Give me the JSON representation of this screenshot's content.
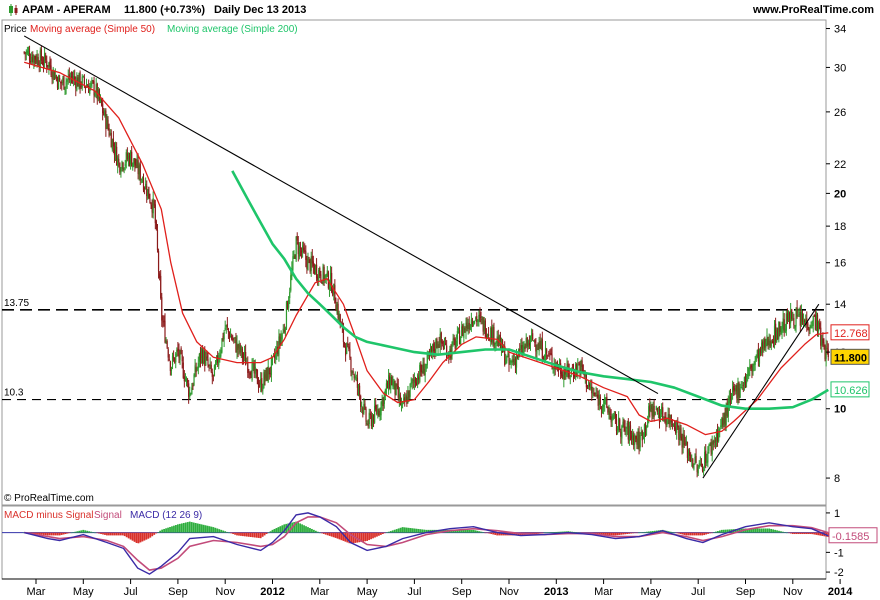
{
  "header": {
    "symbol_line": "APAM - APERAM",
    "price_change": "11.800 (+0.73%)",
    "period_date": "Daily  Dec 13 2013",
    "site": "www.ProRealTime.com",
    "watermark": "© ProRealTime.com"
  },
  "colors": {
    "candle_up": "#2e9a2e",
    "candle_down": "#8b1a1a",
    "ma50": "#e0201c",
    "ma200": "#1fc56a",
    "trendline": "#000000",
    "macd_line": "#3a2aa6",
    "signal_line": "#c24b7a",
    "hist_pos": "#2fae3f",
    "hist_neg": "#d9312b",
    "zero_line": "#3333aa"
  },
  "chart_data": [
    {
      "type": "candlestick",
      "title": "Price",
      "legend": [
        {
          "name": "Price",
          "color": "#000000"
        },
        {
          "name": "Moving average (Simple 50)",
          "color": "#e0201c"
        },
        {
          "name": "Moving average (Simple 200)",
          "color": "#1fc56a"
        }
      ],
      "y_scale": "log",
      "ylim": [
        7.6,
        34.5
      ],
      "y_ticks": [
        34,
        30,
        26,
        22,
        20,
        18,
        16,
        14,
        12,
        10,
        8
      ],
      "y_ticks_bold": [
        20,
        10
      ],
      "x_labels": [
        {
          "label": "Mar",
          "t": 0
        },
        {
          "label": "May",
          "t": 2
        },
        {
          "label": "Jul",
          "t": 4
        },
        {
          "label": "Sep",
          "t": 6
        },
        {
          "label": "Nov",
          "t": 8
        },
        {
          "label": "2012",
          "t": 10,
          "bold": true
        },
        {
          "label": "Mar",
          "t": 12
        },
        {
          "label": "May",
          "t": 14
        },
        {
          "label": "Jul",
          "t": 16
        },
        {
          "label": "Sep",
          "t": 18
        },
        {
          "label": "Nov",
          "t": 20
        },
        {
          "label": "2013",
          "t": 22,
          "bold": true
        },
        {
          "label": "Mar",
          "t": 24
        },
        {
          "label": "May",
          "t": 26
        },
        {
          "label": "Jul",
          "t": 28
        },
        {
          "label": "Sep",
          "t": 30
        },
        {
          "label": "Nov",
          "t": 32
        },
        {
          "label": "2014",
          "t": 34,
          "bold": true
        }
      ],
      "price_path": [
        [
          -0.5,
          31.5
        ],
        [
          0,
          31
        ],
        [
          0.5,
          30.5
        ],
        [
          1,
          28.5
        ],
        [
          1.5,
          29
        ],
        [
          2,
          28.5
        ],
        [
          2.5,
          28
        ],
        [
          3,
          25
        ],
        [
          3.5,
          22
        ],
        [
          4,
          22.5
        ],
        [
          4.5,
          21
        ],
        [
          5,
          19
        ],
        [
          5.3,
          13.5
        ],
        [
          5.7,
          11.5
        ],
        [
          6,
          12
        ],
        [
          6.5,
          10.5
        ],
        [
          7,
          12
        ],
        [
          7.5,
          11
        ],
        [
          8,
          13
        ],
        [
          8.5,
          12.2
        ],
        [
          9,
          11.5
        ],
        [
          9.5,
          10.8
        ],
        [
          10,
          11.5
        ],
        [
          10.5,
          13
        ],
        [
          11,
          17
        ],
        [
          11.5,
          16
        ],
        [
          12,
          15.5
        ],
        [
          12.5,
          15
        ],
        [
          13,
          12.5
        ],
        [
          13.5,
          11
        ],
        [
          14,
          9.5
        ],
        [
          14.5,
          10
        ],
        [
          15,
          11
        ],
        [
          15.5,
          10
        ],
        [
          16,
          11
        ],
        [
          16.5,
          11.5
        ],
        [
          17,
          12.5
        ],
        [
          17.5,
          12
        ],
        [
          18,
          12.8
        ],
        [
          18.5,
          13.5
        ],
        [
          19,
          13
        ],
        [
          19.5,
          12.5
        ],
        [
          20,
          11.5
        ],
        [
          20.5,
          12
        ],
        [
          21,
          12.5
        ],
        [
          21.5,
          12
        ],
        [
          22,
          11.5
        ],
        [
          22.5,
          11.2
        ],
        [
          23,
          11.5
        ],
        [
          23.5,
          10.5
        ],
        [
          24,
          10.2
        ],
        [
          24.5,
          9.5
        ],
        [
          25,
          9.3
        ],
        [
          25.5,
          9
        ],
        [
          26,
          10
        ],
        [
          26.5,
          9.8
        ],
        [
          27,
          9.6
        ],
        [
          27.5,
          8.8
        ],
        [
          28,
          8.2
        ],
        [
          28.5,
          8.8
        ],
        [
          29,
          9.5
        ],
        [
          29.5,
          10.5
        ],
        [
          30,
          11
        ],
        [
          30.5,
          11.8
        ],
        [
          31,
          12.5
        ],
        [
          31.5,
          13
        ],
        [
          32,
          13.5
        ],
        [
          32.5,
          13.2
        ],
        [
          33,
          13.3
        ],
        [
          33.2,
          12.4
        ],
        [
          33.5,
          11.8
        ]
      ],
      "series": [
        {
          "name": "Moving average (Simple 50)",
          "color": "#e0201c",
          "values": [
            [
              -0.5,
              30.5
            ],
            [
              1,
              29.5
            ],
            [
              2.5,
              27.8
            ],
            [
              3.5,
              25.5
            ],
            [
              4.5,
              22
            ],
            [
              5.3,
              19
            ],
            [
              5.7,
              16
            ],
            [
              6.2,
              13.6
            ],
            [
              6.8,
              12.4
            ],
            [
              7.5,
              11.8
            ],
            [
              8.5,
              11.6
            ],
            [
              9.5,
              11.6
            ],
            [
              10,
              11.8
            ],
            [
              10.5,
              12.5
            ],
            [
              11,
              13.5
            ],
            [
              11.8,
              15
            ],
            [
              12.3,
              15.2
            ],
            [
              13,
              14
            ],
            [
              13.5,
              12.6
            ],
            [
              14,
              11.3
            ],
            [
              14.7,
              10.5
            ],
            [
              15.3,
              10.2
            ],
            [
              16,
              10.3
            ],
            [
              16.6,
              10.9
            ],
            [
              17.2,
              11.6
            ],
            [
              18,
              12.3
            ],
            [
              18.6,
              12.6
            ],
            [
              19.5,
              12.5
            ],
            [
              20,
              12
            ],
            [
              21,
              11.7
            ],
            [
              22,
              11.4
            ],
            [
              23,
              11.1
            ],
            [
              24,
              10.7
            ],
            [
              25,
              10.4
            ],
            [
              25.5,
              9.8
            ],
            [
              26,
              9.6
            ],
            [
              26.7,
              9.7
            ],
            [
              27.5,
              9.5
            ],
            [
              28.3,
              9.2
            ],
            [
              29,
              9.3
            ],
            [
              29.5,
              9.6
            ],
            [
              30.5,
              10.3
            ],
            [
              31.5,
              11.4
            ],
            [
              32.5,
              12.3
            ],
            [
              33,
              12.7
            ],
            [
              33.5,
              12.77
            ]
          ]
        },
        {
          "name": "Moving average (Simple 200)",
          "color": "#1fc56a",
          "values": [
            [
              8.3,
              21.5
            ],
            [
              9,
              19.5
            ],
            [
              9.5,
              18.2
            ],
            [
              10,
              17
            ],
            [
              10.5,
              16.2
            ],
            [
              11,
              15.2
            ],
            [
              11.5,
              14.5
            ],
            [
              12,
              14
            ],
            [
              12.5,
              13.5
            ],
            [
              13,
              13
            ],
            [
              13.5,
              12.6
            ],
            [
              14,
              12.4
            ],
            [
              15,
              12.2
            ],
            [
              16,
              12
            ],
            [
              17,
              11.9
            ],
            [
              18,
              12
            ],
            [
              19,
              12.1
            ],
            [
              20,
              12.1
            ],
            [
              21,
              11.8
            ],
            [
              22,
              11.5
            ],
            [
              23,
              11.25
            ],
            [
              24,
              11.1
            ],
            [
              25,
              11
            ],
            [
              26,
              10.9
            ],
            [
              27,
              10.7
            ],
            [
              28,
              10.4
            ],
            [
              29,
              10.1
            ],
            [
              30,
              10
            ],
            [
              31,
              10
            ],
            [
              32,
              10.05
            ],
            [
              32.8,
              10.3
            ],
            [
              33.5,
              10.626
            ]
          ]
        }
      ],
      "levels": [
        {
          "label": "13.75",
          "value": 13.75
        },
        {
          "label": "10.3",
          "value": 10.3
        }
      ],
      "trendlines": [
        {
          "from": [
            -0.5,
            33.2
          ],
          "to": [
            26.3,
            10.5
          ]
        },
        {
          "from": [
            28.2,
            8.0
          ],
          "to": [
            33.1,
            14.0
          ]
        }
      ],
      "price_tags": [
        {
          "label": "12.768",
          "value": 12.768,
          "style": "outline",
          "color": "#e0201c"
        },
        {
          "label": "11.800",
          "value": 11.8,
          "style": "filled",
          "color": "#ffd500"
        },
        {
          "label": "10.626",
          "value": 10.626,
          "style": "outline",
          "color": "#1fc56a"
        }
      ]
    },
    {
      "type": "line",
      "title": "MACD minus Signal",
      "legend": [
        {
          "name": "MACD minus Signal",
          "color": "#d9312b"
        },
        {
          "name": "Signal",
          "color": "#c24b7a"
        },
        {
          "name": "MACD (12 26 9)",
          "color": "#3a2aa6"
        }
      ],
      "ylim": [
        -2.3,
        1.3
      ],
      "y_ticks": [
        1,
        -1,
        -2
      ],
      "current_value": {
        "label": "-0.1585",
        "value": -0.1585
      },
      "macd_path": [
        [
          -0.5,
          0
        ],
        [
          0.5,
          -0.3
        ],
        [
          1,
          -0.4
        ],
        [
          2,
          -0.1
        ],
        [
          3,
          -0.5
        ],
        [
          3.7,
          -0.8
        ],
        [
          4.3,
          -1.8
        ],
        [
          4.8,
          -2.1
        ],
        [
          5.3,
          -1.7
        ],
        [
          6,
          -1.0
        ],
        [
          6.5,
          -0.3
        ],
        [
          7.5,
          -0.2
        ],
        [
          8.5,
          -0.6
        ],
        [
          9.5,
          -0.9
        ],
        [
          10,
          -0.5
        ],
        [
          10.5,
          0.1
        ],
        [
          11,
          0.9
        ],
        [
          11.5,
          1.0
        ],
        [
          12,
          0.8
        ],
        [
          12.7,
          0.3
        ],
        [
          13.3,
          -0.5
        ],
        [
          14,
          -0.9
        ],
        [
          14.8,
          -0.7
        ],
        [
          15.5,
          -0.3
        ],
        [
          16.5,
          0.0
        ],
        [
          17.5,
          0.2
        ],
        [
          18.5,
          0.3
        ],
        [
          19.5,
          0.0
        ],
        [
          20.5,
          -0.15
        ],
        [
          21.5,
          -0.1
        ],
        [
          22.5,
          0.0
        ],
        [
          23.5,
          -0.1
        ],
        [
          24.5,
          -0.3
        ],
        [
          25.5,
          -0.2
        ],
        [
          26.5,
          0.1
        ],
        [
          27.5,
          -0.3
        ],
        [
          28.2,
          -0.5
        ],
        [
          29,
          -0.1
        ],
        [
          30,
          0.3
        ],
        [
          31,
          0.5
        ],
        [
          32,
          0.3
        ],
        [
          32.8,
          0.2
        ],
        [
          33.5,
          -0.1585
        ]
      ],
      "signal_path": [
        [
          -0.5,
          0
        ],
        [
          0.5,
          -0.2
        ],
        [
          1,
          -0.3
        ],
        [
          2,
          -0.2
        ],
        [
          3,
          -0.4
        ],
        [
          3.7,
          -0.7
        ],
        [
          4.3,
          -1.4
        ],
        [
          4.8,
          -1.9
        ],
        [
          5.3,
          -1.8
        ],
        [
          6,
          -1.3
        ],
        [
          6.5,
          -0.7
        ],
        [
          7.5,
          -0.4
        ],
        [
          8.5,
          -0.5
        ],
        [
          9.5,
          -0.7
        ],
        [
          10,
          -0.6
        ],
        [
          10.5,
          -0.2
        ],
        [
          11,
          0.5
        ],
        [
          11.5,
          0.8
        ],
        [
          12,
          0.8
        ],
        [
          12.7,
          0.5
        ],
        [
          13.3,
          -0.1
        ],
        [
          14,
          -0.6
        ],
        [
          14.8,
          -0.7
        ],
        [
          15.5,
          -0.5
        ],
        [
          16.5,
          -0.1
        ],
        [
          17.5,
          0.1
        ],
        [
          18.5,
          0.2
        ],
        [
          19.5,
          0.1
        ],
        [
          20.5,
          -0.05
        ],
        [
          21.5,
          -0.1
        ],
        [
          22.5,
          -0.05
        ],
        [
          23.5,
          -0.05
        ],
        [
          24.5,
          -0.2
        ],
        [
          25.5,
          -0.2
        ],
        [
          26.5,
          0.0
        ],
        [
          27.5,
          -0.2
        ],
        [
          28.2,
          -0.4
        ],
        [
          29,
          -0.2
        ],
        [
          30,
          0.15
        ],
        [
          31,
          0.35
        ],
        [
          32,
          0.35
        ],
        [
          32.8,
          0.25
        ],
        [
          33.5,
          0.0
        ]
      ]
    }
  ]
}
